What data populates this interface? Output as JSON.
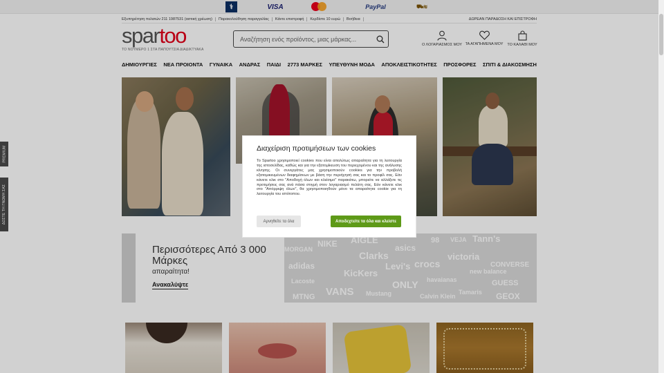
{
  "payment_bar": {
    "maestro_label": "⚕",
    "visa_label": "VISA",
    "mastercard_label": "mastercard",
    "paypal_label": "PayPal",
    "other_label": "⛟≋"
  },
  "info_bar": {
    "customer_service": "Εξυπηρέτηση πελατών 211 1987531 (αστική χρέωση)",
    "order_tracking": "Παρακολούθηση παραγγελίας",
    "returns": "Κάντε επιστροφή",
    "earn": "Κερδίστε 10 ευρώ",
    "help": "Βοήθεια",
    "free_delivery": "ΔΩΡΕΑΝ ΠΑΡΑΔΟΣΗ ΚΑΙ ΕΠΙΣΤΡΟΦΗ"
  },
  "header": {
    "logo_part1": "spar",
    "logo_part2": "too",
    "tagline": "ΤΟ ΝΟΥΜΕΡΟ 1 ΣΤΑ ΠΑΠΟΥΤΣΙΑ ΔΙΑΔΙΚΤΥΑΚΑ",
    "search_placeholder": "Αναζήτηση ενός προϊόντος, μιας μάρκας...",
    "account_label": "Ο ΛΟΓΑΡΙΑΣΜΟΣ ΜΟΥ",
    "wishlist_label": "ΤΑ ΑΓΑΠΗΜΕΝΑ ΜΟΥ",
    "cart_label": "ΤΟ ΚΑΛΑΘΙ ΜΟΥ"
  },
  "nav": {
    "items": [
      "ΔΗΜΙΟΥΡΓΙΕΣ",
      "ΝΕΑ ΠΡΟΙΟΝΤΑ",
      "ΓΥΝΑΙΚΑ",
      "ΑΝΔΡΑΣ",
      "ΠΑΙΔΙ",
      "2773 ΜΑΡΚΕΣ",
      "ΥΠΕΥΘΥΝΗ ΜΟΔΑ",
      "ΑΠΟΚΛΕΙΣΤΙΚΟΤΗΤΕΣ",
      "ΠΡΟΣΦΟΡΕΣ",
      "ΣΠΙΤΙ & ΔΙΑΚΟΣΜΗΣΗ"
    ]
  },
  "side_tabs": {
    "premium": "PREMIUM",
    "opinion": "ΔΩΣΤΕ ΤΗ ΓΝΩΜΗ ΣΑΣ"
  },
  "banner": {
    "title_line1": "Περισσότερες Από 3 000",
    "title_line2": "Μάρκες",
    "subtitle": "απαραίτητα!",
    "link": "Ανακαλύψτε",
    "brands": [
      "NIKE",
      "AIGLE",
      "asics",
      "98",
      "VEJA",
      "Tann's",
      "MORGAN",
      "Clarks",
      "Levi's",
      "crocs",
      "victoria",
      "adidas",
      "KicKers",
      "new balance",
      "CONVERSE",
      "Lacoste",
      "ONLY",
      "havaianas",
      "GUESS",
      "VANS",
      "Mustang",
      "Tamaris",
      "GEOX",
      "MTNG",
      "Calvin Klein"
    ]
  },
  "cookie_modal": {
    "title": "Διαχείριση προτιμήσεων των cookies",
    "body": "Το Spartoo χρησιμοποιεί cookies που είναι απολύτως απαραίτητα για τη λειτουργία της ιστοσελίδας, καθώς και για την εξατομίκευση του περιεχομένου και της ανάλυσης κίνησης. Οι συνεργάτες μας χρησιμοποιούν cookies για την προβολή εξατομικευμένων διαφημίσεων με βάση την περιήγησή σας και το προφίλ σας. Εάν κάνετε κλικ στο \"Αποδοχή όλων και κλείσιμο\" παρακάτω, μπορείτε να αλλάξετε τις προτιμήσεις σας ανά πάσα στιγμή στον λογαριασμό πελάτη σας. Εάν κάνετε κλικ στο \"Απόρριψη όλων\", θα χρησιμοποιηθούν μόνο τα απαραίτητα cookie για τη λειτουργία του ιστότοπου.",
    "reject_label": "Αρνηθείτε τα όλα",
    "accept_label": "Αποδεχτείτε τα όλα και κλείστε"
  },
  "colors": {
    "brand_red": "#e2001a",
    "accept_green": "#5e9a18"
  }
}
